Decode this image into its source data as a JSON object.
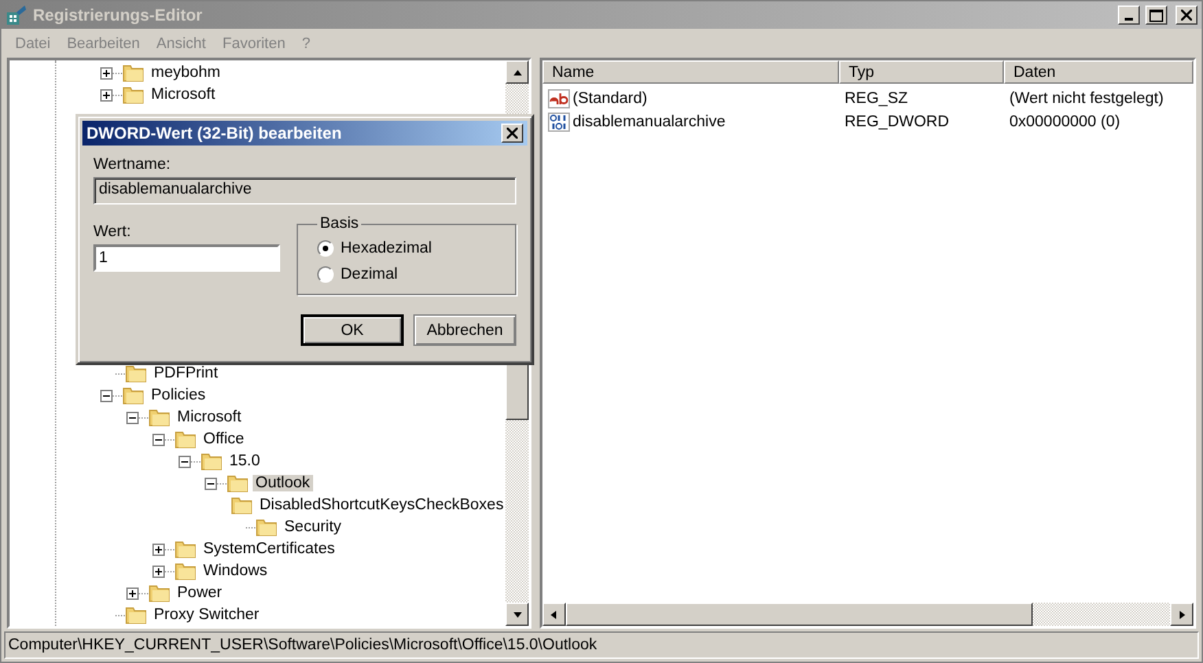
{
  "window": {
    "title": "Registrierungs-Editor",
    "active": false
  },
  "menu": [
    "Datei",
    "Bearbeiten",
    "Ansicht",
    "Favoriten",
    "?"
  ],
  "tree": {
    "items_top": [
      {
        "label": "meybohm",
        "expanded": false,
        "selected": false
      },
      {
        "label": "Microsoft",
        "expanded": false,
        "selected": false
      }
    ],
    "items_bottom": [
      {
        "label": "PDFPrint",
        "selected": false
      },
      {
        "label": "Policies",
        "expanded": true,
        "selected": false,
        "children": [
          {
            "label": "Microsoft",
            "expanded": true,
            "selected": false,
            "children": [
              {
                "label": "Office",
                "expanded": true,
                "selected": false,
                "children": [
                  {
                    "label": "15.0",
                    "expanded": true,
                    "selected": false,
                    "children": [
                      {
                        "label": "Outlook",
                        "expanded": true,
                        "selected": true,
                        "children": [
                          {
                            "label": "DisabledShortcutKeysCheckBoxes",
                            "selected": false
                          },
                          {
                            "label": "Security",
                            "selected": false
                          }
                        ]
                      }
                    ]
                  }
                ]
              },
              {
                "label": "SystemCertificates",
                "expanded": false,
                "selected": false
              },
              {
                "label": "Windows",
                "expanded": false,
                "selected": false
              }
            ]
          },
          {
            "label": "Power",
            "expanded": false,
            "selected": false
          }
        ]
      },
      {
        "label": "Proxy Switcher",
        "selected": false
      }
    ]
  },
  "values": {
    "columns": [
      "Name",
      "Typ",
      "Daten"
    ],
    "rows": [
      {
        "kind": "sz",
        "name": "(Standard)",
        "type": "REG_SZ",
        "data": "(Wert nicht festgelegt)"
      },
      {
        "kind": "dword",
        "name": "disablemanualarchive",
        "type": "REG_DWORD",
        "data": "0x00000000 (0)"
      }
    ]
  },
  "dialog": {
    "title": "DWORD-Wert (32-Bit) bearbeiten",
    "name_label": "Wertname:",
    "name_value": "disablemanualarchive",
    "value_label": "Wert:",
    "value": "1",
    "base_label": "Basis",
    "bases": [
      {
        "label": "Hexadezimal",
        "selected": true
      },
      {
        "label": "Dezimal",
        "selected": false
      }
    ],
    "buttons": [
      {
        "label": "OK",
        "default": true
      },
      {
        "label": "Abbrechen",
        "default": false
      }
    ]
  },
  "status_bar": "Computer\\HKEY_CURRENT_USER\\Software\\Policies\\Microsoft\\Office\\15.0\\Outlook"
}
